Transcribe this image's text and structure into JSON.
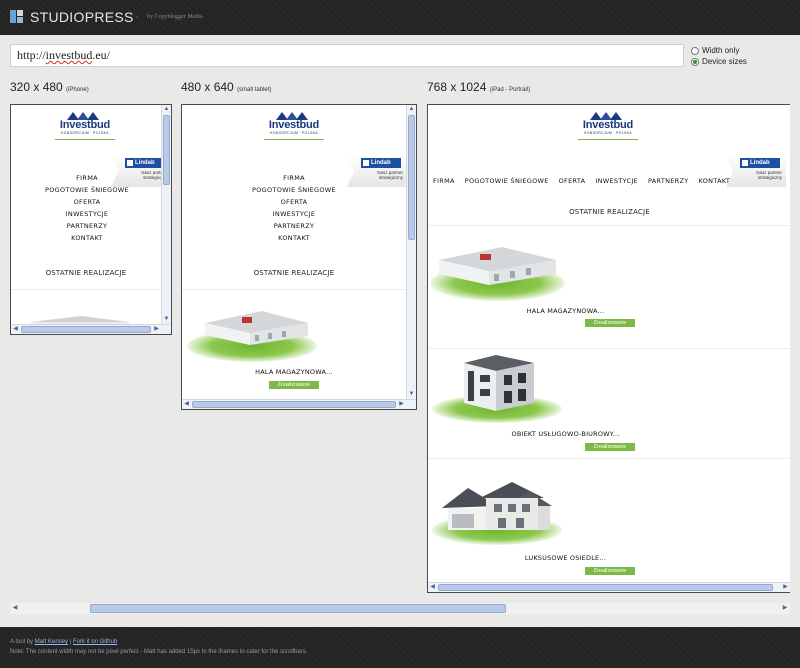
{
  "header": {
    "brand": "STUDIOPRESS",
    "byline_arrow": "»",
    "byline": "by Copyblogger Media"
  },
  "url": {
    "prefix": "http://",
    "domain": "investbud",
    "suffix": ".eu/"
  },
  "options": {
    "width_only": "Width only",
    "device_sizes": "Device sizes",
    "selected": "Device sizes"
  },
  "devices": [
    {
      "size": "320 x 480",
      "name": "(iPhone)"
    },
    {
      "size": "480 x 640",
      "name": "(small tablet)"
    },
    {
      "size": "768 x 1024",
      "name": "(iPad - Portrait)"
    }
  ],
  "site": {
    "logo_name": "Investbud",
    "logo_sub": "KONSORCJUM · POLSKA",
    "partner_brand": "Lindab",
    "partner_text": "Nasz partner strategiczny",
    "menu": [
      "FIRMA",
      "POGOTOWIE ŚNIEGOWE",
      "OFERTA",
      "INWESTYCJE",
      "PARTNERZY",
      "KONTAKT"
    ],
    "section_title": "OSTATNIE REALIZACJE",
    "projects": [
      {
        "title": "HALA MAGAZYNOWA...",
        "status": "Zrealizowane"
      },
      {
        "title": "OBIEKT USŁUGOWO-BIUROWY...",
        "status": "Zrealizowane"
      },
      {
        "title": "LUKSUSOWE OSIEDLE...",
        "status": "Zrealizowane"
      }
    ]
  },
  "footer": {
    "line1_prefix": "A tool by",
    "author": "Matt Kersley",
    "sep": "|",
    "fork": "Fork it on Github",
    "note": "Note: The content width may not be pixel perfect - Matt has added 15px to the iframes to cater for the scrollbars."
  }
}
